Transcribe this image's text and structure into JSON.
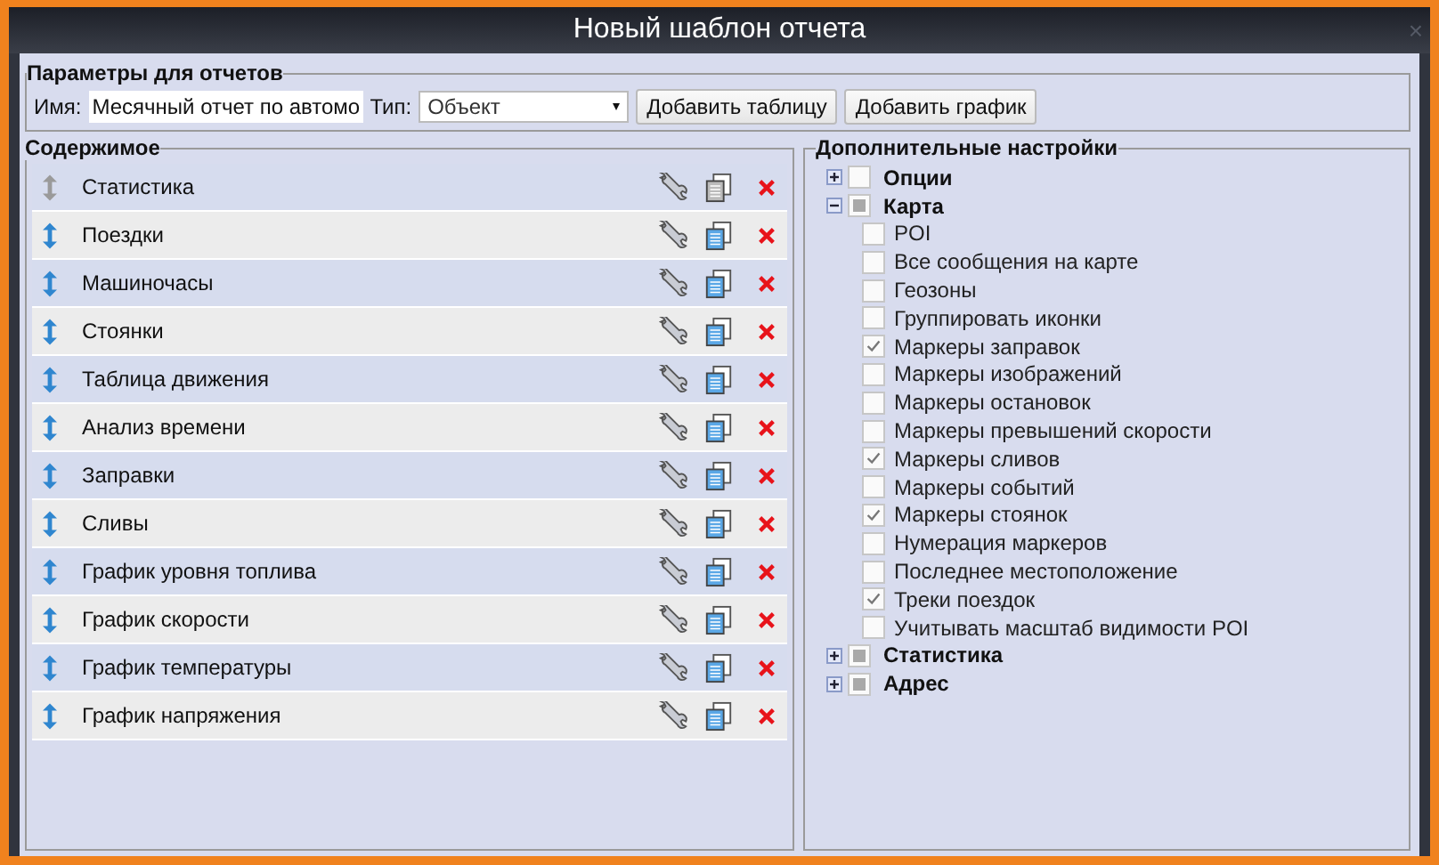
{
  "window": {
    "title": "Новый шаблон отчета",
    "close": "×"
  },
  "params": {
    "legend": "Параметры для отчетов",
    "name_label": "Имя:",
    "name_value": "Месячный отчет по автомо",
    "type_label": "Тип:",
    "type_value": "Объект",
    "buttons": [
      "Добавить таблицу",
      "Добавить график"
    ]
  },
  "content": {
    "legend": "Содержимое",
    "items": [
      {
        "label": "Статистика",
        "disabled": true
      },
      {
        "label": "Поездки",
        "disabled": false
      },
      {
        "label": "Машиночасы",
        "disabled": false
      },
      {
        "label": "Стоянки",
        "disabled": false
      },
      {
        "label": "Таблица движения",
        "disabled": false
      },
      {
        "label": "Анализ времени",
        "disabled": false
      },
      {
        "label": "Заправки",
        "disabled": false
      },
      {
        "label": "Сливы",
        "disabled": false
      },
      {
        "label": "График уровня топлива",
        "disabled": false
      },
      {
        "label": "График скорости",
        "disabled": false
      },
      {
        "label": "График температуры",
        "disabled": false
      },
      {
        "label": "График напряжения",
        "disabled": false
      }
    ]
  },
  "settings": {
    "legend": "Дополнительные настройки",
    "groups": [
      {
        "label": "Опции",
        "expanded": false,
        "partial": false
      },
      {
        "label": "Карта",
        "expanded": true,
        "partial": true,
        "children": [
          {
            "label": "POI",
            "checked": false
          },
          {
            "label": "Все сообщения на карте",
            "checked": false
          },
          {
            "label": "Геозоны",
            "checked": false
          },
          {
            "label": "Группировать иконки",
            "checked": false
          },
          {
            "label": "Маркеры заправок",
            "checked": true
          },
          {
            "label": "Маркеры изображений",
            "checked": false
          },
          {
            "label": "Маркеры остановок",
            "checked": false
          },
          {
            "label": "Маркеры превышений скорости",
            "checked": false
          },
          {
            "label": "Маркеры сливов",
            "checked": true
          },
          {
            "label": "Маркеры событий",
            "checked": false
          },
          {
            "label": "Маркеры стоянок",
            "checked": true
          },
          {
            "label": "Нумерация маркеров",
            "checked": false
          },
          {
            "label": "Последнее местоположение",
            "checked": false
          },
          {
            "label": "Треки поездок",
            "checked": true
          },
          {
            "label": "Учитывать масштаб видимости POI",
            "checked": false
          }
        ]
      },
      {
        "label": "Статистика",
        "expanded": false,
        "partial": true
      },
      {
        "label": "Адрес",
        "expanded": false,
        "partial": true
      }
    ]
  }
}
